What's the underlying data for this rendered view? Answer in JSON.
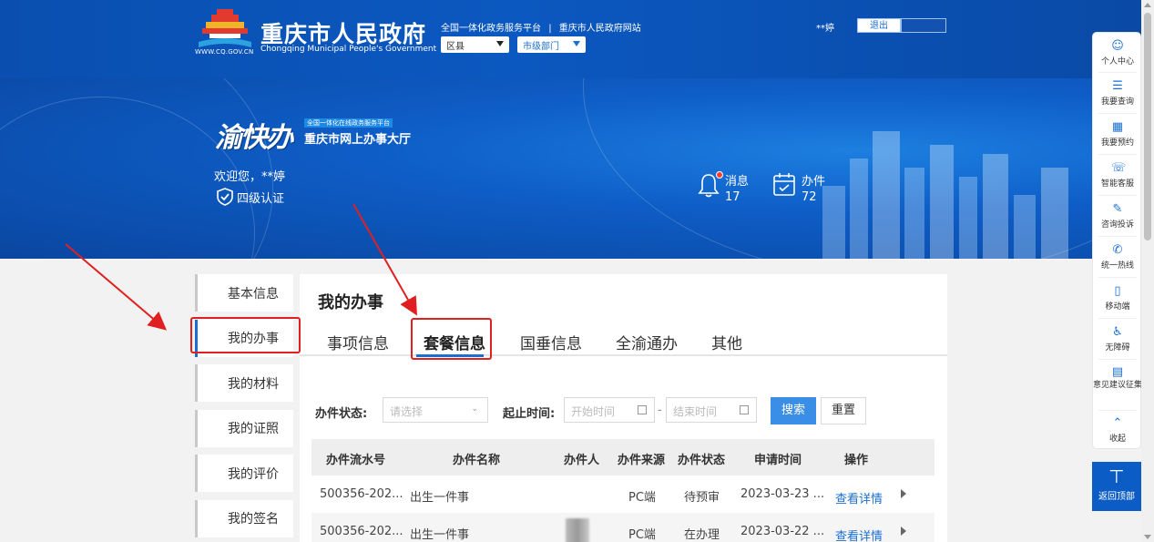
{
  "header": {
    "site_name": "重庆市人民政府",
    "site_name_en": "Chongqing Municipal People's Government",
    "site_url": "WWW.CQ.GOV.CN",
    "link_platform": "全国一体化政务服务平台",
    "link_separator": "|",
    "link_portal": "重庆市人民政府网站",
    "district_select": "区县",
    "dept_select": "市级部门",
    "username": "**婷",
    "logout_label": "退出"
  },
  "hero": {
    "brand_script": "渝快办",
    "brand_tag": "全国一体化在线政务服务平台",
    "brand_hall": "重庆市网上办事大厅",
    "welcome": "欢迎您，**婷",
    "cert_level": "四级认证",
    "messages_label": "消息",
    "messages_count": "17",
    "cases_label": "办件",
    "cases_count": "72"
  },
  "sidebar": {
    "items": [
      {
        "label": "基本信息"
      },
      {
        "label": "我的办事"
      },
      {
        "label": "我的材料"
      },
      {
        "label": "我的证照"
      },
      {
        "label": "我的评价"
      },
      {
        "label": "我的签名"
      }
    ]
  },
  "main": {
    "title": "我的办事",
    "tabs": [
      {
        "label": "事项信息"
      },
      {
        "label": "套餐信息"
      },
      {
        "label": "国垂信息"
      },
      {
        "label": "全渝通办"
      },
      {
        "label": "其他"
      }
    ],
    "filter": {
      "status_label": "办件状态:",
      "status_placeholder": "请选择",
      "time_label": "起止时间:",
      "start_placeholder": "开始时间",
      "range_sep": "-",
      "end_placeholder": "结束时间",
      "search_label": "搜索",
      "reset_label": "重置"
    },
    "table": {
      "headers": [
        "办件流水号",
        "办件名称",
        "办件人",
        "办件来源",
        "办件状态",
        "申请时间",
        "操作"
      ],
      "rows": [
        {
          "serial": "500356-202...",
          "name": "出生一件事",
          "person": "",
          "source": "PC端",
          "status": "待预审",
          "date": "2023-03-23 ...",
          "action": "查看详情"
        },
        {
          "serial": "500356-202...",
          "name": "出生一件事",
          "person": "",
          "source": "PC端",
          "status": "在办理",
          "date": "2023-03-22 ...",
          "action": "查看详情"
        }
      ]
    }
  },
  "right_nav": {
    "items": [
      {
        "label": "个人中心",
        "icon": "person-icon"
      },
      {
        "label": "我要查询",
        "icon": "search-list-icon"
      },
      {
        "label": "我要预约",
        "icon": "calendar-icon"
      },
      {
        "label": "智能客服",
        "icon": "headset-icon"
      },
      {
        "label": "咨询投诉",
        "icon": "edit-icon"
      },
      {
        "label": "统一热线",
        "icon": "phone-icon"
      },
      {
        "label": "移动端",
        "icon": "mobile-icon"
      },
      {
        "label": "无障碍",
        "icon": "accessibility-icon"
      },
      {
        "label": "意见建议征集",
        "icon": "feedback-icon"
      },
      {
        "label": "收起",
        "icon": "chevron-up-icon"
      }
    ],
    "back_to_top": "返回顶部"
  },
  "colors": {
    "brand_blue": "#0b58c0",
    "accent": "#1a6fd4",
    "annotation_red": "#e02020"
  }
}
